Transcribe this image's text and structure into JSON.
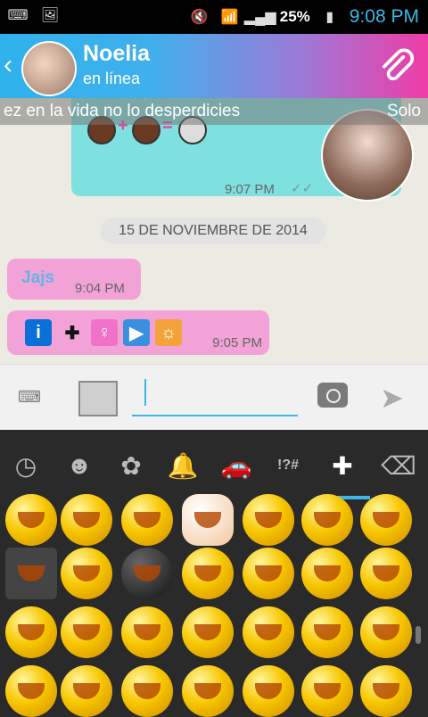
{
  "status": {
    "battery": "25%",
    "time": "9:08 PM",
    "icons": [
      "keyboard-icon",
      "image-icon",
      "mute-icon",
      "wifi-icon",
      "signal-icon",
      "battery-icon"
    ]
  },
  "header": {
    "name": "Noelia",
    "status": "en línea",
    "icons": [
      "back-chevron-icon",
      "contact-avatar",
      "paperclip-icon"
    ],
    "accent_gradient": [
      "#2fb2ec",
      "#9b7ad8",
      "#f03ca6"
    ]
  },
  "ticker": {
    "left": "ez en la vida no lo desperdicies",
    "right": "Solo"
  },
  "messages": {
    "outgoing_time": "9:07 PM",
    "date_chip": "15 DE NOVIEMBRE DE 2014",
    "incoming": [
      {
        "text": "Jajs",
        "time": "9:04 PM"
      },
      {
        "text": "",
        "time": "9:05 PM"
      }
    ]
  },
  "input": {
    "icons": [
      "keyboard-icon",
      "gallery-icon",
      "camera-icon",
      "send-icon"
    ]
  },
  "emoji_tabs": [
    {
      "name": "recent-tab",
      "glyph": "◷"
    },
    {
      "name": "smiley-tab",
      "glyph": "☻"
    },
    {
      "name": "flower-tab",
      "glyph": "✿"
    },
    {
      "name": "bell-tab",
      "glyph": "🔔"
    },
    {
      "name": "car-tab",
      "glyph": "🚗"
    },
    {
      "name": "symbols-tab",
      "glyph": "!?#"
    },
    {
      "name": "plus-tab",
      "glyph": "✚"
    },
    {
      "name": "backspace-tab",
      "glyph": "⌫"
    }
  ]
}
